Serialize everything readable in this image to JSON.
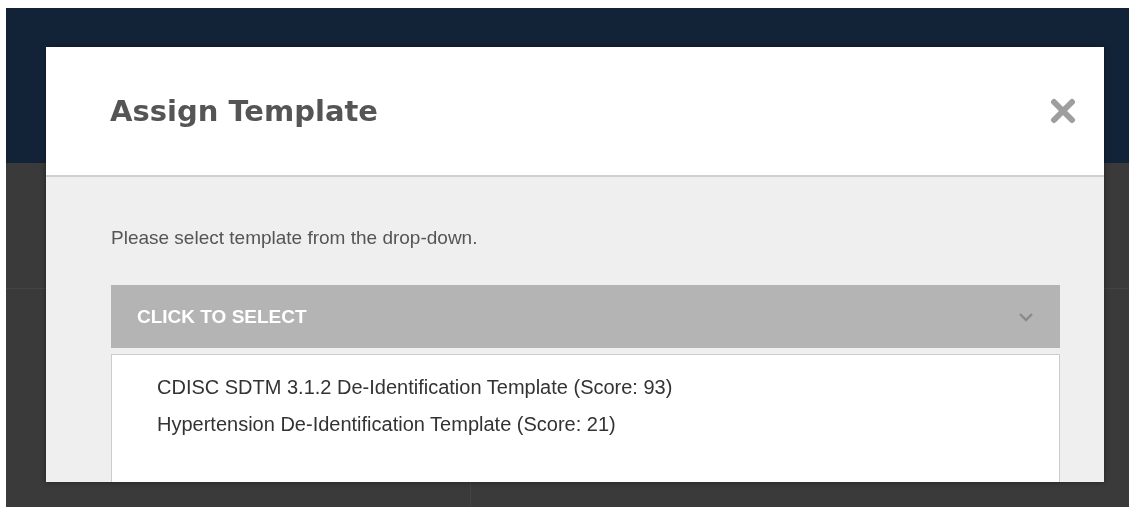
{
  "dialog": {
    "title": "Assign Template",
    "instruction": "Please select template from the drop-down.",
    "dropdown": {
      "placeholder": "CLICK TO SELECT",
      "expanded": true,
      "options": [
        {
          "label": "CDISC SDTM 3.1.2 De-Identification Template (Score: 93)",
          "selected": false
        },
        {
          "label": "Hypertension De-Identification Template (Score: 21)",
          "selected": false
        }
      ]
    }
  }
}
